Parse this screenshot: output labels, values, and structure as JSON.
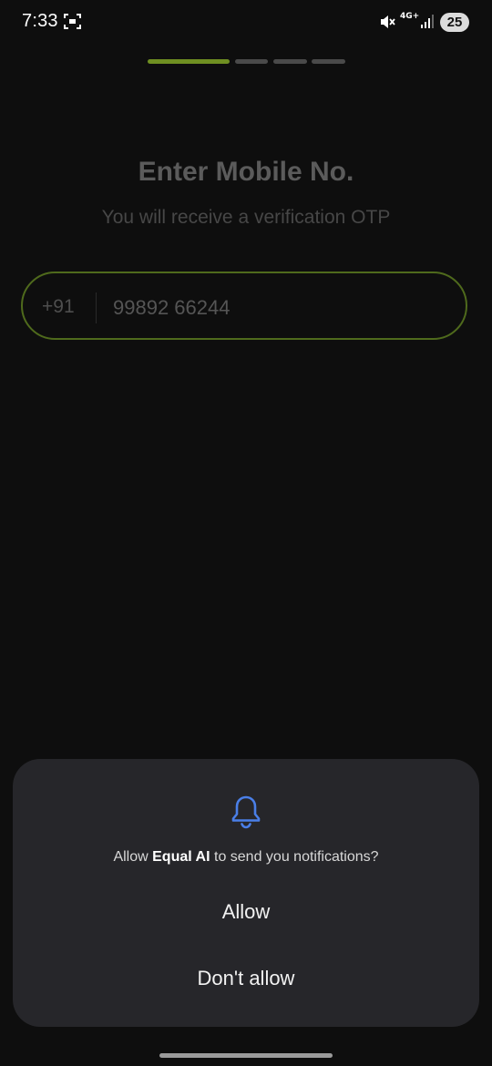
{
  "status_bar": {
    "time": "7:33",
    "network": "4G+",
    "battery": "25",
    "icons": [
      "screenshot-icon",
      "mute-icon",
      "network-icon",
      "signal-icon",
      "battery-icon"
    ]
  },
  "progress": {
    "total_steps": 4,
    "current_step": 1
  },
  "page": {
    "title": "Enter Mobile No.",
    "subtitle": "You will receive a verification OTP"
  },
  "phone_input": {
    "country_code": "+91",
    "value": "99892 66244"
  },
  "dialog": {
    "icon": "bell-icon",
    "message_prefix": "Allow ",
    "app_name": "Equal AI",
    "message_suffix": " to send you notifications?",
    "allow_label": "Allow",
    "deny_label": "Don't allow"
  },
  "colors": {
    "accent": "#6f8f22",
    "dialog_bg": "#26262a",
    "bell": "#4a7fe8"
  }
}
